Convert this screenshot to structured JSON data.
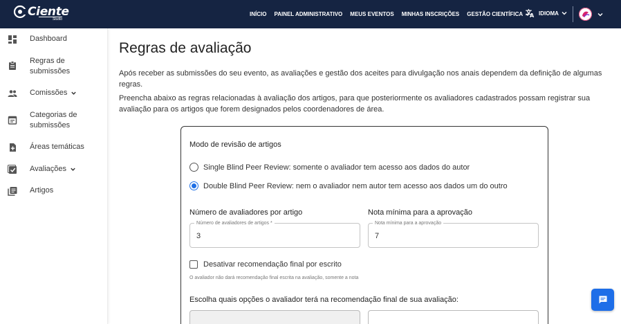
{
  "brand": {
    "name": "Ciente",
    "sub": "Studio"
  },
  "nav": {
    "items": [
      {
        "label": "INÍCIO"
      },
      {
        "label": "PAINEL ADMINISTRATIVO"
      },
      {
        "label": "MEUS EVENTOS"
      },
      {
        "label": "MINHAS INSCRIÇÕES"
      },
      {
        "label": "GESTÃO CIENTÍFICA"
      }
    ],
    "language_label": "IDIOMA"
  },
  "sidebar": {
    "items": [
      {
        "label": "Dashboard",
        "icon": "dashboard-icon"
      },
      {
        "label": "Regras de submissões",
        "icon": "assignment-icon"
      },
      {
        "label": "Comissões",
        "icon": "people-icon"
      },
      {
        "label": "Categorias de submissões",
        "icon": "event-note-icon"
      },
      {
        "label": "Áreas temáticas",
        "icon": "note-add-icon"
      },
      {
        "label": "Avaliações",
        "icon": "check-box-icon"
      },
      {
        "label": "Artigos",
        "icon": "library-books-icon"
      }
    ]
  },
  "main": {
    "title": "Regras de avaliação",
    "para1": "Após receber as submissões do seu evento, as avaliações e gestão dos aceites para divulgação nos anais dependem da definição de algumas regras.",
    "para2": "Preencha abaixo as regras relacionadas à avaliação dos artigos, para que posteriormente os avaliadores cadastrados possam registrar sua avaliação para os artigos que forem designados pelos coordenadores de área."
  },
  "form": {
    "mode_title": "Modo de revisão de artigos",
    "option_single": "Single Blind Peer Review: somente o avaliador tem acesso aos dados do autor",
    "option_double": "Double Blind Peer Review: nem o avaliador nem autor tem acesso aos dados um do outro",
    "selected_option": "double",
    "reviewers_title": "Número de avaliadores por artigo",
    "reviewers_label": "Número de avaliadores de artigos *",
    "reviewers_value": "3",
    "min_grade_title": "Nota mínima para a aprovação",
    "min_grade_label": "Nota mínima para a aprovação",
    "min_grade_value": "7",
    "disable_label": "Desativar recomendação final por escrito",
    "disable_checked": false,
    "helper": "O avaliador não dará recomendação final escrita na avaliação, somente a nota",
    "choose_title": "Escolha quais opções o avaliador terá na recomendação final de sua avaliação:"
  },
  "colors": {
    "topbar": "#152442",
    "accent": "#1f6fe5",
    "chat": "#1e6ee8"
  }
}
